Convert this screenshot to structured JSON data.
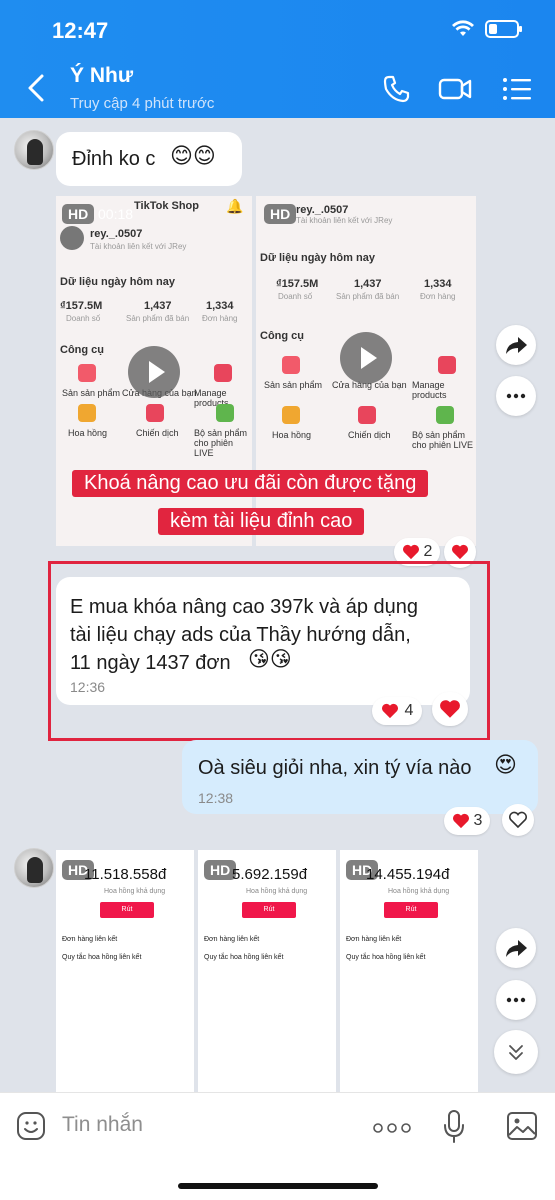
{
  "status_bar": {
    "time": "12:47",
    "battery_level": 0.3
  },
  "header": {
    "title": "Ý Như",
    "subtitle": "Truy cập 4 phút trước",
    "icons": [
      "back-arrow-icon",
      "phone-icon",
      "video-call-icon",
      "menu-list-icon"
    ]
  },
  "messages": {
    "first": {
      "text": "Đỉnh ko c",
      "emoji": "😊😊"
    },
    "video1": {
      "hd": "HD",
      "duration": "00:18",
      "app_title": "TikTok Shop",
      "user": "rey._.0507",
      "linked": "Tài khoản liên kết với JRey",
      "section": "Dữ liệu ngày hôm nay",
      "stats": [
        {
          "value": "₫157.5M",
          "label": "Doanh số"
        },
        {
          "value": "1,437",
          "label": "Sản phẩm đã bán"
        },
        {
          "value": "1,334",
          "label": "Đơn hàng"
        }
      ],
      "tools_title": "Công cụ",
      "tools": [
        "Sản sản phẩm",
        "Cửa hàng của bạn",
        "Manage products",
        "Hoa hồng",
        "Chiến dịch",
        "Bộ sản phẩm cho phiên LIVE"
      ]
    },
    "video2": {
      "hd": "HD",
      "user": "rey._.0507",
      "linked": "Tài khoản liên kết với JRey",
      "section": "Dữ liệu ngày hôm nay",
      "stats": [
        {
          "value": "₫157.5M",
          "label": "Doanh số"
        },
        {
          "value": "1,437",
          "label": "Sản phẩm đã bán"
        },
        {
          "value": "1,334",
          "label": "Đơn hàng"
        }
      ],
      "tools_title": "Công cụ",
      "tools": [
        "Sản sản phẩm",
        "Cửa hàng của bạn",
        "Manage products",
        "Hoa hồng",
        "Chiến dịch",
        "Bộ sản phẩm cho phiên LIVE"
      ]
    },
    "banner_line1": "Khoá nâng cao ưu đãi còn được tặng",
    "banner_line2": "kèm tài liệu đỉnh cao",
    "video_reaction_count": "2",
    "highlighted": {
      "text_line1": "E mua khóa nâng cao 397k và áp dụng",
      "text_line2": "tài liệu chạy ads của Thầy hướng dẫn,",
      "text_line3": "11 ngày 1437 đơn",
      "emoji": "😘😘",
      "time": "12:36",
      "reaction_count": "4"
    },
    "reply": {
      "text": "Oà siêu giỏi nha, xin tý vía nào",
      "emoji": "😍",
      "time": "12:38",
      "reaction_count": "3"
    },
    "earnings": [
      {
        "hd": "HD",
        "amount": "11.518.558đ",
        "sub": "Hoa hồng khả dụng",
        "button": "Rút",
        "row1": "Đơn hàng liên kết",
        "row2": "Quy tắc hoa hồng liên kết"
      },
      {
        "hd": "HD",
        "amount": "5.692.159đ",
        "sub": "Hoa hồng khả dụng",
        "button": "Rút",
        "row1": "Đơn hàng liên kết",
        "row2": "Quy tắc hoa hồng liên kết"
      },
      {
        "hd": "HD",
        "amount": "14.455.194đ",
        "sub": "Hoa hồng khả dụng",
        "button": "Rút",
        "row1": "Đơn hàng liên kết",
        "row2": "Quy tắc hoa hồng liên kết"
      }
    ]
  },
  "input": {
    "placeholder": "Tin nhắn"
  },
  "colors": {
    "header_blue": "#1f8df0",
    "accent_red": "#e1253f",
    "my_bubble": "#d6ecfd"
  }
}
